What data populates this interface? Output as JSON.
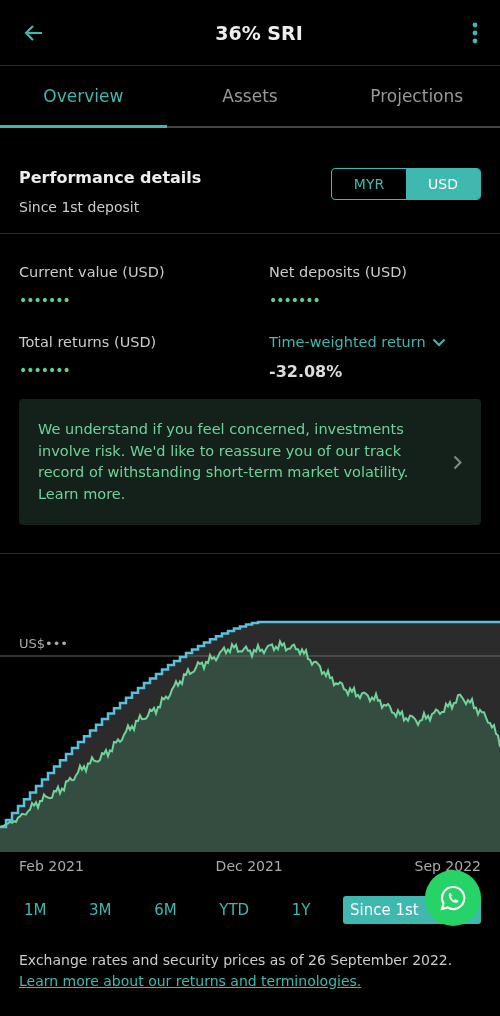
{
  "header": {
    "title": "36% SRI"
  },
  "tabs": [
    {
      "label": "Overview",
      "selected": true
    },
    {
      "label": "Assets",
      "selected": false
    },
    {
      "label": "Projections",
      "selected": false
    }
  ],
  "performance": {
    "title": "Performance details",
    "subtitle": "Since 1st deposit",
    "currencies": [
      {
        "label": "MYR",
        "selected": false
      },
      {
        "label": "USD",
        "selected": true
      }
    ]
  },
  "metrics": [
    {
      "label": "Current value (USD)",
      "value": "•••••••",
      "kind": "hidden"
    },
    {
      "label": "Net deposits (USD)",
      "value": "•••••••",
      "kind": "hidden"
    },
    {
      "label": "Total returns (USD)",
      "value": "•••••••",
      "kind": "hidden"
    },
    {
      "label": "Time-weighted return",
      "value": "-32.08%",
      "kind": "dropdown"
    }
  ],
  "notice": {
    "text": "We understand if you feel concerned, investments involve risk. We'd like to reassure you of our track record of withstanding short-term market volatility. Learn more."
  },
  "chart": {
    "reference_label": "US$•••",
    "x_labels": [
      "Feb 2021",
      "Dec 2021",
      "Sep 2022"
    ]
  },
  "ranges": [
    {
      "label": "1M",
      "selected": false
    },
    {
      "label": "3M",
      "selected": false
    },
    {
      "label": "6M",
      "selected": false
    },
    {
      "label": "YTD",
      "selected": false
    },
    {
      "label": "1Y",
      "selected": false
    },
    {
      "label": "Since 1st",
      "selected": true
    }
  ],
  "footer": {
    "text": "Exchange rates and security prices as of 26 September 2022.",
    "link": "Learn more about our returns and terminologies."
  }
}
